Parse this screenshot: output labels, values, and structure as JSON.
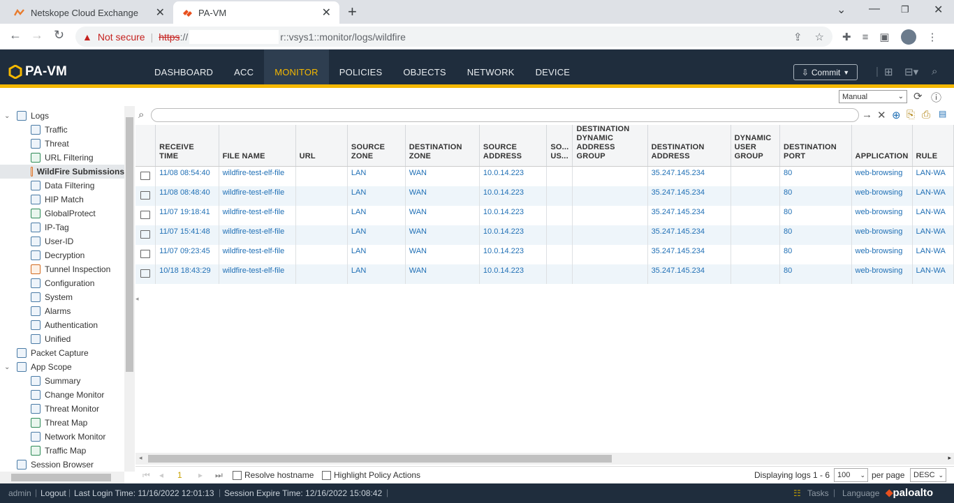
{
  "browser": {
    "tabs": [
      {
        "title": "Netskope Cloud Exchange",
        "active": false
      },
      {
        "title": "PA-VM",
        "active": true
      }
    ],
    "address": {
      "security_label": "Not secure",
      "scheme": "https",
      "scheme_sep": "://",
      "path": "r::vsys1::monitor/logs/wildfire"
    }
  },
  "app": {
    "logo": "PA-VM",
    "nav": [
      "DASHBOARD",
      "ACC",
      "MONITOR",
      "POLICIES",
      "OBJECTS",
      "NETWORK",
      "DEVICE"
    ],
    "selected_nav": "MONITOR",
    "commit_label": "Commit",
    "refresh_mode": "Manual",
    "accent_color": "#f5b800"
  },
  "sidebar": {
    "items": [
      {
        "label": "Logs",
        "level": 0,
        "caret": "v"
      },
      {
        "label": "Traffic",
        "level": 1
      },
      {
        "label": "Threat",
        "level": 1
      },
      {
        "label": "URL Filtering",
        "level": 1
      },
      {
        "label": "WildFire Submissions",
        "level": 1,
        "selected": true
      },
      {
        "label": "Data Filtering",
        "level": 1
      },
      {
        "label": "HIP Match",
        "level": 1
      },
      {
        "label": "GlobalProtect",
        "level": 1
      },
      {
        "label": "IP-Tag",
        "level": 1
      },
      {
        "label": "User-ID",
        "level": 1
      },
      {
        "label": "Decryption",
        "level": 1
      },
      {
        "label": "Tunnel Inspection",
        "level": 1
      },
      {
        "label": "Configuration",
        "level": 1
      },
      {
        "label": "System",
        "level": 1
      },
      {
        "label": "Alarms",
        "level": 1
      },
      {
        "label": "Authentication",
        "level": 1
      },
      {
        "label": "Unified",
        "level": 1
      },
      {
        "label": "Packet Capture",
        "level": 0
      },
      {
        "label": "App Scope",
        "level": 0,
        "caret": "v"
      },
      {
        "label": "Summary",
        "level": 1
      },
      {
        "label": "Change Monitor",
        "level": 1
      },
      {
        "label": "Threat Monitor",
        "level": 1
      },
      {
        "label": "Threat Map",
        "level": 1
      },
      {
        "label": "Network Monitor",
        "level": 1
      },
      {
        "label": "Traffic Map",
        "level": 1
      },
      {
        "label": "Session Browser",
        "level": 0
      }
    ]
  },
  "table": {
    "columns": [
      "",
      "RECEIVE TIME",
      "FILE NAME",
      "URL",
      "SOURCE ZONE",
      "DESTINATION ZONE",
      "SOURCE ADDRESS",
      "SO... US...",
      "DESTINATION DYNAMIC ADDRESS GROUP",
      "DESTINATION ADDRESS",
      "DYNAMIC USER GROUP",
      "DESTINATION PORT",
      "APPLICATION",
      "RULE"
    ],
    "rows": [
      [
        "11/08 08:54:40",
        "wildfire-test-elf-file",
        "",
        "LAN",
        "WAN",
        "10.0.14.223",
        "",
        "",
        "35.247.145.234",
        "",
        "80",
        "web-browsing",
        "LAN-WA"
      ],
      [
        "11/08 08:48:40",
        "wildfire-test-elf-file",
        "",
        "LAN",
        "WAN",
        "10.0.14.223",
        "",
        "",
        "35.247.145.234",
        "",
        "80",
        "web-browsing",
        "LAN-WA"
      ],
      [
        "11/07 19:18:41",
        "wildfire-test-elf-file",
        "",
        "LAN",
        "WAN",
        "10.0.14.223",
        "",
        "",
        "35.247.145.234",
        "",
        "80",
        "web-browsing",
        "LAN-WA"
      ],
      [
        "11/07 15:41:48",
        "wildfire-test-elf-file",
        "",
        "LAN",
        "WAN",
        "10.0.14.223",
        "",
        "",
        "35.247.145.234",
        "",
        "80",
        "web-browsing",
        "LAN-WA"
      ],
      [
        "11/07 09:23:45",
        "wildfire-test-elf-file",
        "",
        "LAN",
        "WAN",
        "10.0.14.223",
        "",
        "",
        "35.247.145.234",
        "",
        "80",
        "web-browsing",
        "LAN-WA"
      ],
      [
        "10/18 18:43:29",
        "wildfire-test-elf-file",
        "",
        "LAN",
        "WAN",
        "10.0.14.223",
        "",
        "",
        "35.247.145.234",
        "",
        "80",
        "web-browsing",
        "LAN-WA"
      ]
    ]
  },
  "pager": {
    "page": "1",
    "resolve_hostname": "Resolve hostname",
    "highlight_policy": "Highlight Policy Actions",
    "displaying": "Displaying logs 1 - 6",
    "per_page_value": "100",
    "per_page_label": "per page",
    "order": "DESC"
  },
  "status": {
    "user": "admin",
    "logout": "Logout",
    "last_login": "Last Login Time: 11/16/2022 12:01:13",
    "session_expire": "Session Expire Time: 12/16/2022 15:08:42",
    "tasks": "Tasks",
    "language": "Language",
    "brand": "paloalto"
  }
}
